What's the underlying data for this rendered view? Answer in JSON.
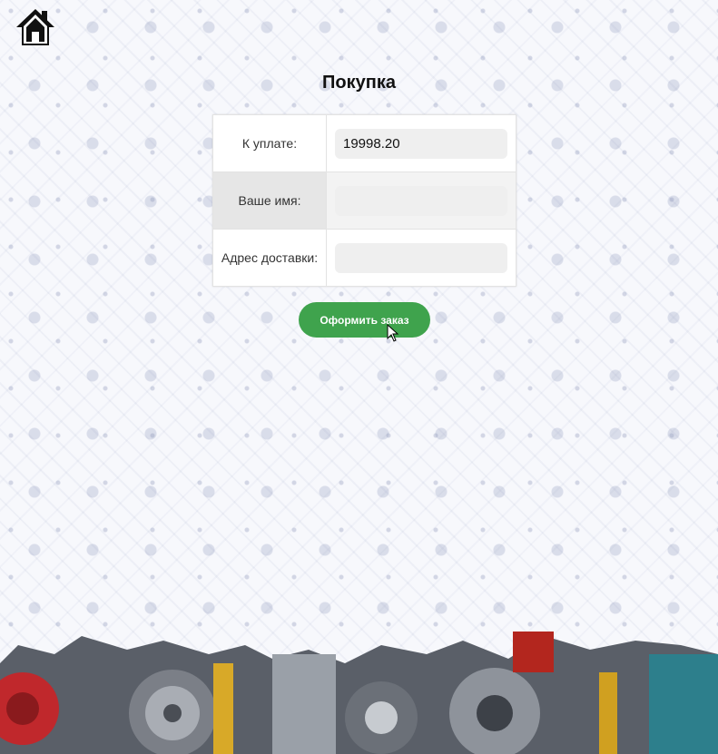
{
  "page": {
    "title": "Покупка"
  },
  "home": {
    "icon": "home-icon"
  },
  "form": {
    "rows": [
      {
        "label": "К уплате:",
        "value": "19998.20",
        "placeholder": ""
      },
      {
        "label": "Ваше имя:",
        "value": "",
        "placeholder": ""
      },
      {
        "label": "Адрес доставки:",
        "value": "",
        "placeholder": ""
      }
    ],
    "submit_label": "Оформить заказ"
  },
  "colors": {
    "accent": "#3fa34d",
    "background": "#f7f8fc"
  }
}
